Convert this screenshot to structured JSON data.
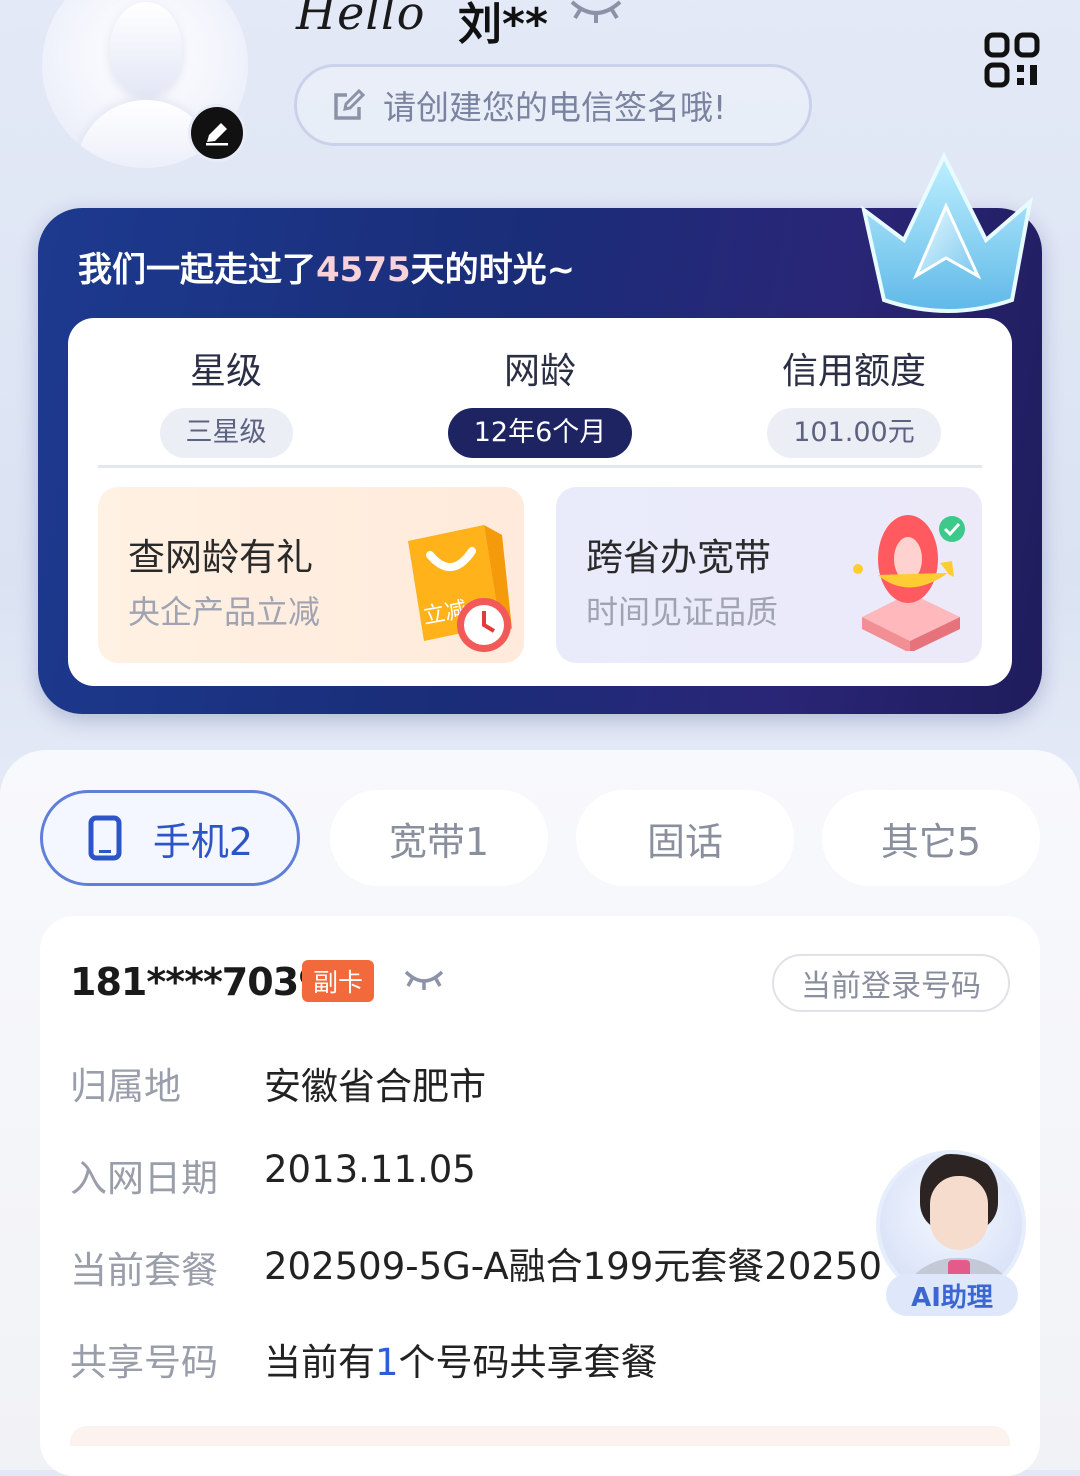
{
  "header": {
    "greeting": "Hello",
    "username": "刘**",
    "signature_prompt": "请创建您的电信签名哦!",
    "qr_icon": "qr-code-icon"
  },
  "journey": {
    "prefix": "我们一起走过了",
    "days": "4575",
    "suffix": "天的时光~"
  },
  "stats": [
    {
      "label": "星级",
      "value": "三星级"
    },
    {
      "label": "网龄",
      "value": "12年6个月"
    },
    {
      "label": "信用额度",
      "value": "101.00元"
    }
  ],
  "promos": [
    {
      "title": "查网龄有礼",
      "subtitle": "央企产品立减",
      "bag_text": "立减"
    },
    {
      "title": "跨省办宽带",
      "subtitle": "时间见证品质"
    }
  ],
  "tabs": [
    {
      "label": "手机2",
      "active": true
    },
    {
      "label": "宽带1"
    },
    {
      "label": "固话"
    },
    {
      "label": "其它5"
    }
  ],
  "line": {
    "number": "181****7039",
    "badge": "副卡",
    "current_login": "当前登录号码",
    "rows": [
      {
        "label": "归属地",
        "value": "安徽省合肥市"
      },
      {
        "label": "入网日期",
        "value": "2013.11.05"
      },
      {
        "label": "当前套餐",
        "value": "202509-5G-A融合199元套餐20250"
      },
      {
        "label": "共享号码",
        "prefix": "当前有",
        "count": "1",
        "suffix": "个号码共享套餐"
      }
    ]
  },
  "assistant": {
    "label": "AI助理"
  },
  "colors": {
    "accent": "#2e55c7",
    "dark_card": "#1d2a78",
    "badge": "#f26a3c",
    "days_highlight": "#f8d2d8"
  }
}
